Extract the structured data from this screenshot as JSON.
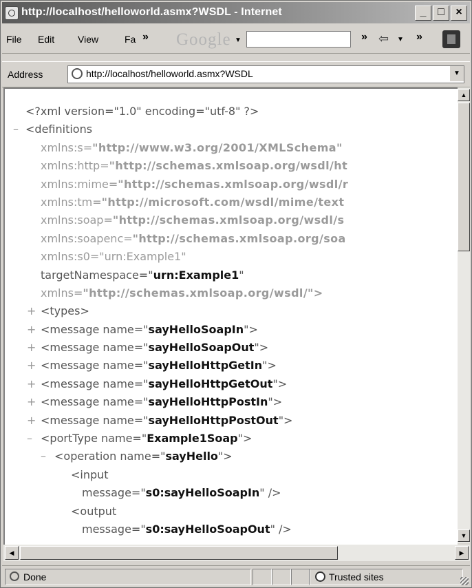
{
  "window": {
    "title": "http://localhost/helloworld.asmx?WSDL - Internet",
    "minimize": "_",
    "maximize": "□",
    "close": "×"
  },
  "menu": {
    "file": "File",
    "edit": "Edit",
    "view": "View",
    "favorites": "Fa",
    "more1": "»",
    "google": "Google",
    "more2": "»",
    "more3": "»"
  },
  "address": {
    "label": "Address",
    "url": "http://localhost/helloworld.asmx?WSDL"
  },
  "xml": {
    "decl": "<?xml version=\"1.0\" encoding=\"utf-8\" ?>",
    "definitions_open": "<definitions",
    "ns": [
      {
        "attr": "xmlns:s=",
        "value": "\"http://www.w3.org/2001/XMLSchema\""
      },
      {
        "attr": "xmlns:http=",
        "value": "\"http://schemas.xmlsoap.org/wsdl/ht"
      },
      {
        "attr": "xmlns:mime=",
        "value": "\"http://schemas.xmlsoap.org/wsdl/r"
      },
      {
        "attr": "xmlns:tm=",
        "value": "\"http://microsoft.com/wsdl/mime/text"
      },
      {
        "attr": "xmlns:soap=",
        "value": "\"http://schemas.xmlsoap.org/wsdl/s"
      },
      {
        "attr": "xmlns:soapenc=",
        "value": "\"http://schemas.xmlsoap.org/soa"
      },
      {
        "attr": "xmlns:s0=",
        "value": "\"urn:Example1\""
      }
    ],
    "target_attr": "targetNamespace=\"",
    "target_value": "urn:Example1",
    "target_close": "\"",
    "xmlns_attr": "xmlns=",
    "xmlns_value": "\"http://schemas.xmlsoap.org/wsdl/\">",
    "types": "<types>",
    "message_prefix": "<message name=\"",
    "message_suffix": "\">",
    "messages": [
      "sayHelloSoapIn",
      "sayHelloSoapOut",
      "sayHelloHttpGetIn",
      "sayHelloHttpGetOut",
      "sayHelloHttpPostIn",
      "sayHelloHttpPostOut"
    ],
    "porttype_prefix": "<portType name=\"",
    "porttype_name": "Example1Soap",
    "porttype_suffix": "\">",
    "operation_prefix": "<operation name=\"",
    "operation_name": "sayHello",
    "operation_suffix": "\">",
    "input_open": "<input",
    "input_attr": "message=\"",
    "input_value": "s0:sayHelloSoapIn",
    "input_close": "\" />",
    "output_open": "<output",
    "output_attr": "message=\"",
    "output_value": "s0:sayHelloSoapOut",
    "output_close": "\" />",
    "plus": "+",
    "minus": "–"
  },
  "status": {
    "text": "Done",
    "zone": "Trusted sites"
  }
}
